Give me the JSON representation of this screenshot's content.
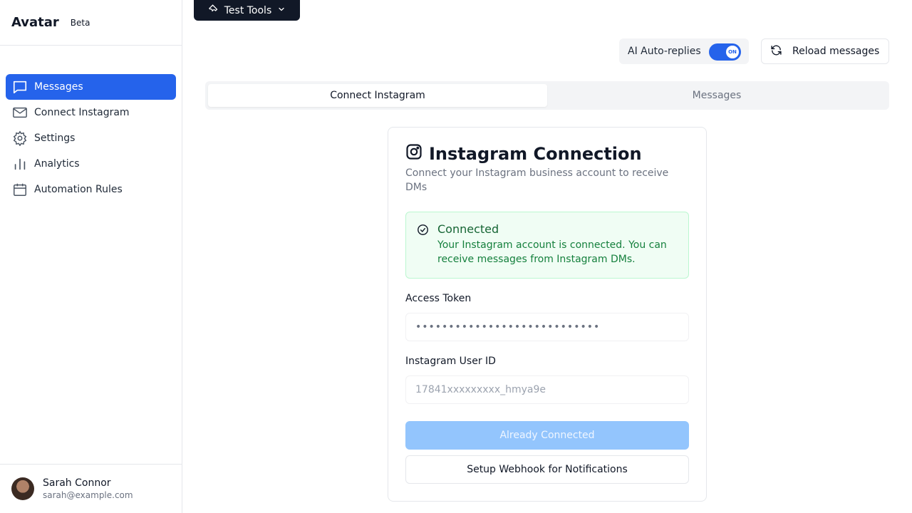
{
  "brand": {
    "name": "Avatar",
    "badge": "Beta"
  },
  "nav": {
    "items": [
      {
        "label": "Messages",
        "icon": "message-square-icon",
        "active": true
      },
      {
        "label": "Connect Instagram",
        "icon": "mail-icon",
        "active": false
      },
      {
        "label": "Settings",
        "icon": "gear-icon",
        "active": false
      },
      {
        "label": "Analytics",
        "icon": "bar-chart-icon",
        "active": false
      },
      {
        "label": "Automation Rules",
        "icon": "calendar-icon",
        "active": false
      }
    ]
  },
  "user": {
    "name": "Sarah Connor",
    "email": "sarah@example.com"
  },
  "topbar": {
    "test_tools_label": "Test Tools",
    "auto_replies_label": "AI Auto-replies",
    "auto_replies_state": "ON",
    "reload_label": "Reload messages"
  },
  "tabs": [
    {
      "label": "Connect Instagram",
      "active": true
    },
    {
      "label": "Messages",
      "active": false
    }
  ],
  "card": {
    "title": "Instagram Connection",
    "description": "Connect your Instagram business account to receive DMs",
    "alert": {
      "title": "Connected",
      "text": "Your Instagram account is connected. You can receive messages from Instagram DMs."
    },
    "access_token": {
      "label": "Access Token",
      "value": "••••••••••••••••••••••••••••"
    },
    "user_id": {
      "label": "Instagram User ID",
      "placeholder": "17841xxxxxxxxx_hmya9e"
    },
    "primary_button": "Already Connected",
    "secondary_button": "Setup Webhook for Notifications"
  },
  "colors": {
    "accent": "#2563eb",
    "success_bg": "#f0fdf4",
    "success_text": "#166534",
    "disabled_button": "#93c5fd"
  }
}
